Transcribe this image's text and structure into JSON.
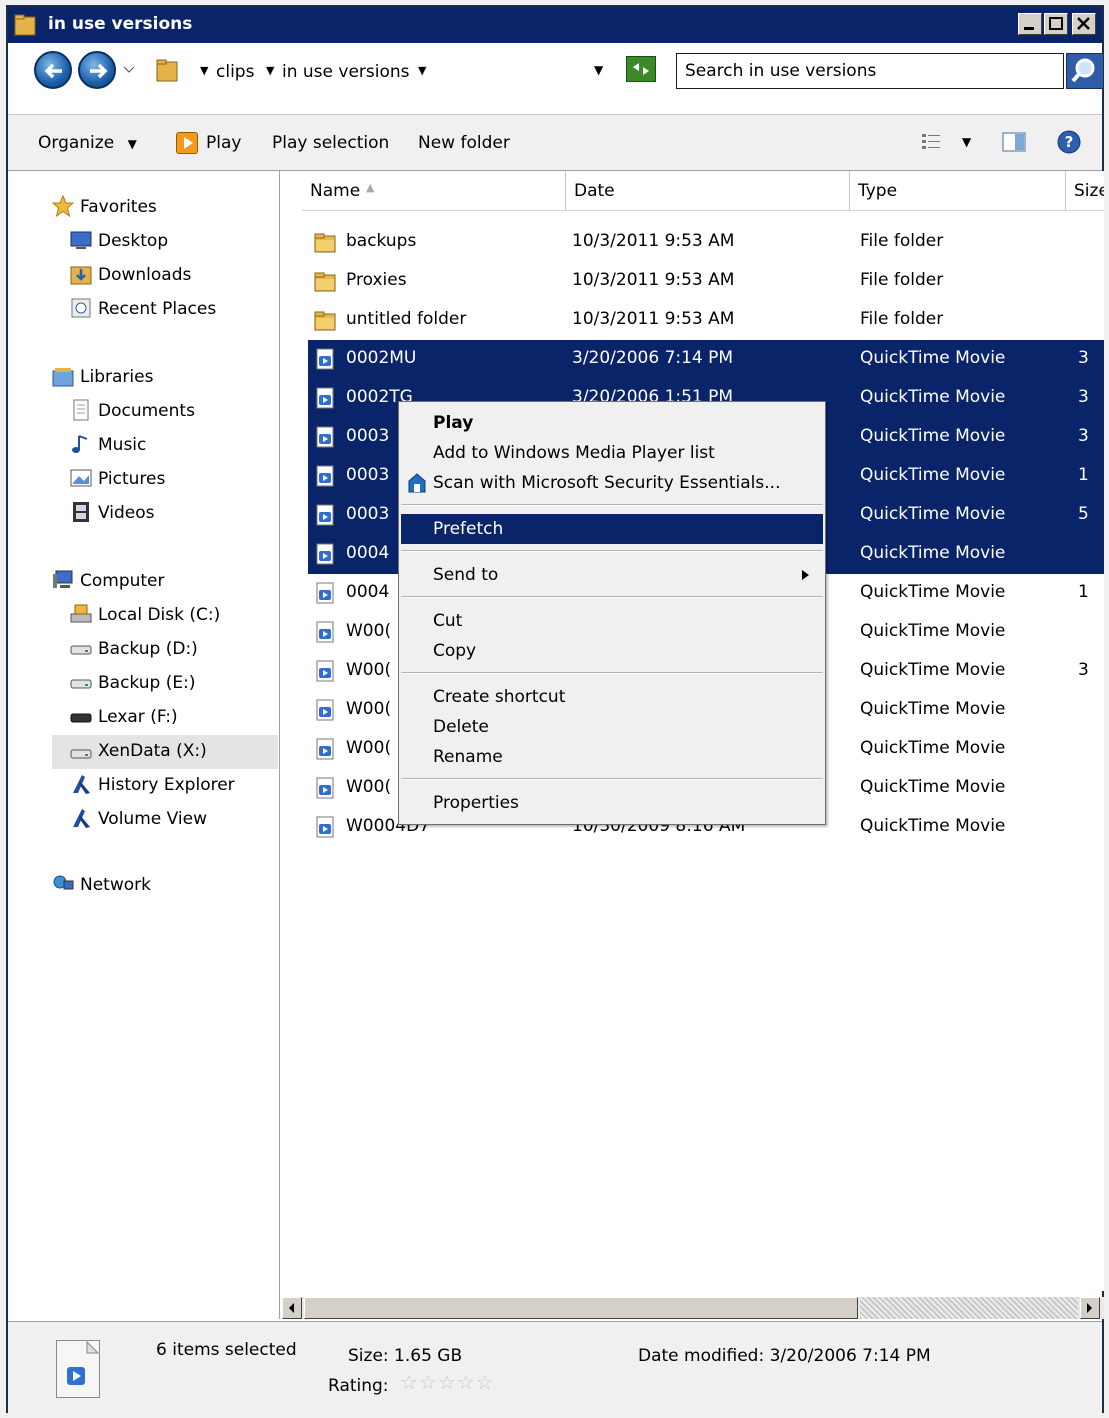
{
  "window": {
    "title": "in use versions",
    "title_bar_color": "#0a246a"
  },
  "address_bar": {
    "crumbs": [
      "clips",
      "in use versions"
    ],
    "search_placeholder": "Search in use versions"
  },
  "toolbar": {
    "organize_label": "Organize",
    "play_label": "Play",
    "play_selection_label": "Play selection",
    "new_folder_label": "New folder"
  },
  "sidebar": {
    "groups": [
      {
        "label": "Favorites",
        "icon": "star-icon",
        "items": [
          {
            "label": "Desktop",
            "icon": "desktop-icon"
          },
          {
            "label": "Downloads",
            "icon": "downloads-folder-icon"
          },
          {
            "label": "Recent Places",
            "icon": "recent-places-icon"
          }
        ]
      },
      {
        "label": "Libraries",
        "icon": "libraries-icon",
        "items": [
          {
            "label": "Documents",
            "icon": "documents-icon"
          },
          {
            "label": "Music",
            "icon": "music-icon"
          },
          {
            "label": "Pictures",
            "icon": "pictures-icon"
          },
          {
            "label": "Videos",
            "icon": "videos-icon"
          }
        ]
      },
      {
        "label": "Computer",
        "icon": "computer-icon",
        "items": [
          {
            "label": "Local Disk (C:)",
            "icon": "local-disk-icon"
          },
          {
            "label": "Backup (D:)",
            "icon": "drive-icon"
          },
          {
            "label": "Backup (E:)",
            "icon": "drive-icon"
          },
          {
            "label": "Lexar (F:)",
            "icon": "removable-drive-icon"
          },
          {
            "label": "XenData (X:)",
            "icon": "drive-icon",
            "selected": true
          },
          {
            "label": "History Explorer",
            "icon": "xendata-icon"
          },
          {
            "label": "Volume View",
            "icon": "xendata-icon"
          }
        ]
      },
      {
        "label": "Network",
        "icon": "network-icon",
        "items": []
      }
    ]
  },
  "columns": {
    "name": "Name",
    "date": "Date",
    "type": "Type",
    "size": "Size"
  },
  "files": [
    {
      "name": "backups",
      "date": "10/3/2011 9:53 AM",
      "type": "File folder",
      "size": "",
      "kind": "folder",
      "selected": false
    },
    {
      "name": "Proxies",
      "date": "10/3/2011 9:53 AM",
      "type": "File folder",
      "size": "",
      "kind": "folder",
      "selected": false
    },
    {
      "name": "untitled folder",
      "date": "10/3/2011 9:53 AM",
      "type": "File folder",
      "size": "",
      "kind": "folder",
      "selected": false
    },
    {
      "name": "0002MU",
      "date": "3/20/2006 7:14 PM",
      "type": "QuickTime Movie",
      "size": "3",
      "kind": "movie",
      "selected": true
    },
    {
      "name": "0002TG",
      "date": "3/20/2006 1:51 PM",
      "type": "QuickTime Movie",
      "size": "3",
      "kind": "movie",
      "selected": true
    },
    {
      "name": "0003",
      "date": "",
      "type": "QuickTime Movie",
      "size": "3",
      "kind": "movie",
      "selected": true
    },
    {
      "name": "0003",
      "date": "",
      "type": "QuickTime Movie",
      "size": "1",
      "kind": "movie",
      "selected": true
    },
    {
      "name": "0003",
      "date": "",
      "type": "QuickTime Movie",
      "size": "5",
      "kind": "movie",
      "selected": true
    },
    {
      "name": "0004",
      "date": "",
      "type": "QuickTime Movie",
      "size": "",
      "kind": "movie",
      "selected": true
    },
    {
      "name": "0004",
      "date": "",
      "type": "QuickTime Movie",
      "size": "1",
      "kind": "movie",
      "selected": false
    },
    {
      "name": "W00(",
      "date": "",
      "type": "QuickTime Movie",
      "size": "",
      "kind": "movie",
      "selected": false
    },
    {
      "name": "W00(",
      "date": "",
      "type": "QuickTime Movie",
      "size": "3",
      "kind": "movie",
      "selected": false
    },
    {
      "name": "W00(",
      "date": "",
      "type": "QuickTime Movie",
      "size": "",
      "kind": "movie",
      "selected": false
    },
    {
      "name": "W00(",
      "date": "",
      "type": "QuickTime Movie",
      "size": "",
      "kind": "movie",
      "selected": false
    },
    {
      "name": "W00(",
      "date": "",
      "type": "QuickTime Movie",
      "size": "",
      "kind": "movie",
      "selected": false
    },
    {
      "name": "W0004D7",
      "date": "10/30/2009 8:16 AM",
      "type": "QuickTime Movie",
      "size": "",
      "kind": "movie",
      "selected": false
    }
  ],
  "context_menu": {
    "play": "Play",
    "add_to_wmp": "Add to Windows Media Player list",
    "scan_mse": "Scan with Microsoft Security Essentials...",
    "prefetch": "Prefetch",
    "send_to": "Send to",
    "cut": "Cut",
    "copy": "Copy",
    "create_shortcut": "Create shortcut",
    "delete": "Delete",
    "rename": "Rename",
    "properties": "Properties"
  },
  "details": {
    "selected_count": "6 items selected",
    "size": "Size: 1.65 GB",
    "date_modified": "Date modified: 3/20/2006 7:14 PM",
    "rating_label": "Rating:",
    "rating_stars": "☆☆☆☆☆"
  },
  "colors": {
    "selection": "#0a246a",
    "menu_background": "#f0f0f0"
  }
}
